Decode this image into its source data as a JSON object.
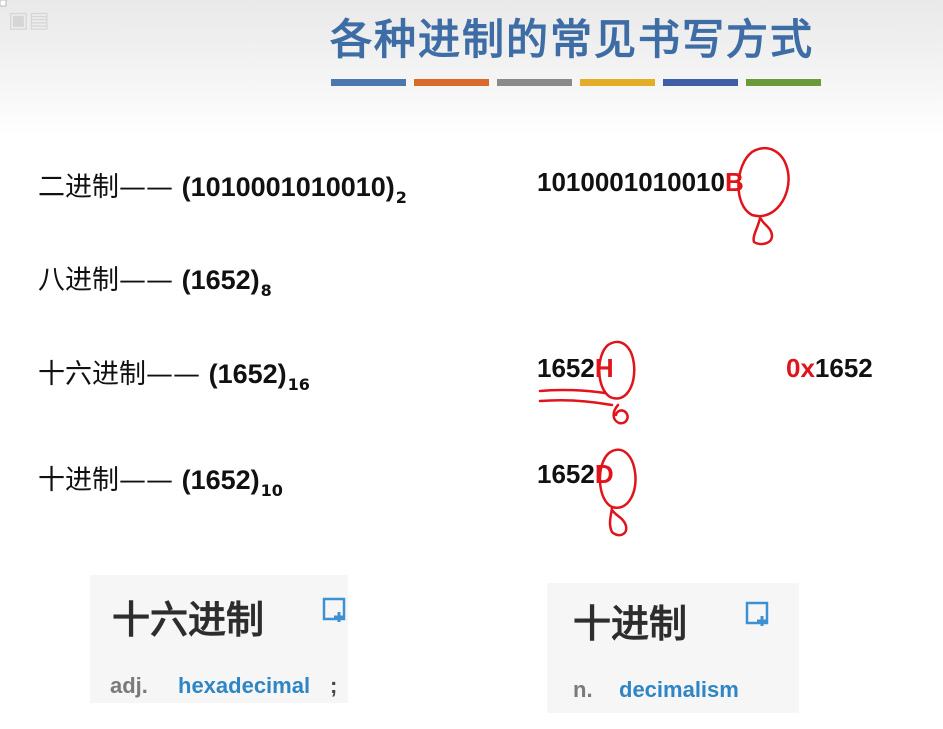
{
  "header": {
    "title": "各种进制的常见书写方式",
    "bar_colors": [
      "#4a79ad",
      "#d86a2b",
      "#8a8a8a",
      "#e3ad27",
      "#3e5ea5",
      "#6a9b3a"
    ]
  },
  "rows": {
    "binary": {
      "label": "二进制——",
      "expr": "(1010001010010)",
      "base": "2",
      "written": "1010001010010",
      "suffix": "B"
    },
    "octal": {
      "label": "八进制——",
      "expr": "(1652)",
      "base": "8"
    },
    "hex": {
      "label": "十六进制——",
      "expr": "(1652)",
      "base": "16",
      "written": "1652",
      "suffix": "H",
      "alt_prefix": "0x",
      "alt_value": "1652"
    },
    "decimal": {
      "label": "十进制——",
      "expr": "(1652)",
      "base": "10",
      "written": "1652",
      "suffix": "D"
    }
  },
  "dictionary": [
    {
      "term": "十六进制",
      "pos": "adj.",
      "definition": "hexadecimal",
      "separator": ";"
    },
    {
      "term": "十进制",
      "pos": "n.",
      "definition": "decimalism"
    }
  ],
  "colors": {
    "accent_red": "#e0141a",
    "title_blue": "#3e6da6",
    "def_blue": "#2f86c5"
  }
}
